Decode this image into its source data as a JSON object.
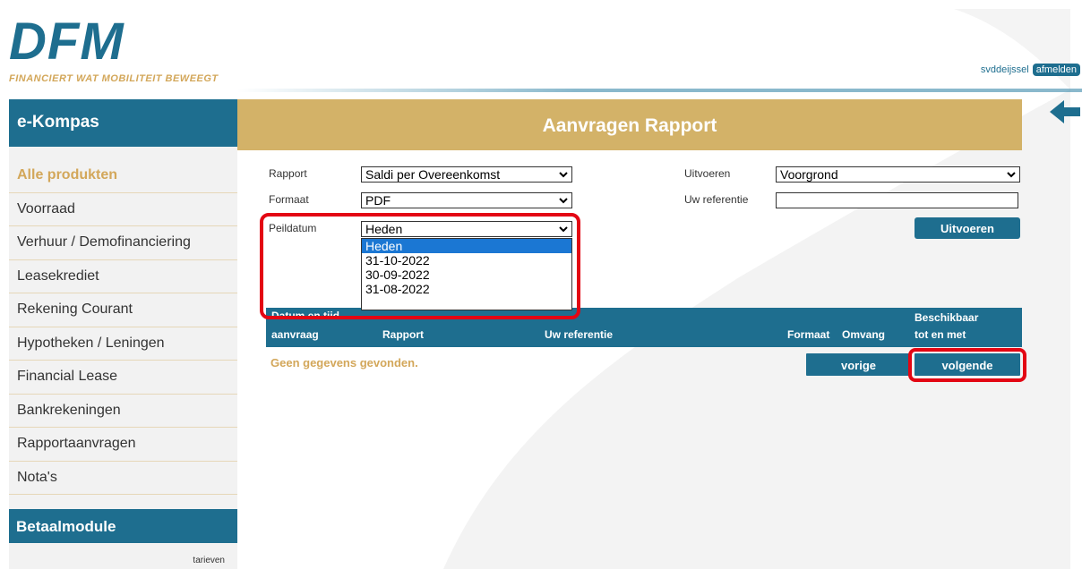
{
  "header": {
    "logo_text": "DFM",
    "tagline": "FINANCIERT WAT MOBILITEIT BEWEEGT",
    "username": "svddeijssel",
    "logout_label": "afmelden"
  },
  "sidebar": {
    "title": "e-Kompas",
    "items": [
      {
        "label": "Alle produkten",
        "active": true
      },
      {
        "label": "Voorraad",
        "active": false
      },
      {
        "label": "Verhuur / Demofinanciering",
        "active": false
      },
      {
        "label": "Leasekrediet",
        "active": false
      },
      {
        "label": "Rekening Courant",
        "active": false
      },
      {
        "label": "Hypotheken / Leningen",
        "active": false
      },
      {
        "label": "Financial Lease",
        "active": false
      },
      {
        "label": "Bankrekeningen",
        "active": false
      },
      {
        "label": "Rapportaanvragen",
        "active": false
      },
      {
        "label": "Nota's",
        "active": false
      }
    ],
    "module_title": "Betaalmodule",
    "tarieven_label": "tarieven"
  },
  "main": {
    "title": "Aanvragen Rapport",
    "form": {
      "rapport_label": "Rapport",
      "rapport_value": "Saldi per Overeenkomst",
      "formaat_label": "Formaat",
      "formaat_value": "PDF",
      "peildatum_label": "Peildatum",
      "peildatum_value": "Heden",
      "peildatum_options": [
        "Heden",
        "31-10-2022",
        "30-09-2022",
        "31-08-2022"
      ],
      "uitvoeren_label": "Uitvoeren",
      "uitvoeren_value": "Voorgrond",
      "referentie_label": "Uw referentie",
      "referentie_value": "",
      "execute_button": "Uitvoeren"
    },
    "table": {
      "col_datum_line1": "Datum en tijd",
      "col_datum_line2": "aanvraag",
      "col_rapport": "Rapport",
      "col_referentie": "Uw referentie",
      "col_formaat": "Formaat",
      "col_omvang": "Omvang",
      "col_beschikbaar_line1": "Beschikbaar",
      "col_beschikbaar_line2": "tot en met",
      "empty_message": "Geen gegevens gevonden.",
      "prev_button": "vorige",
      "next_button": "volgende"
    }
  },
  "colors": {
    "brand_blue": "#1e6e8f",
    "gold": "#d3b268",
    "highlight_red": "#e30613",
    "selected_option": "#1b77d3"
  }
}
